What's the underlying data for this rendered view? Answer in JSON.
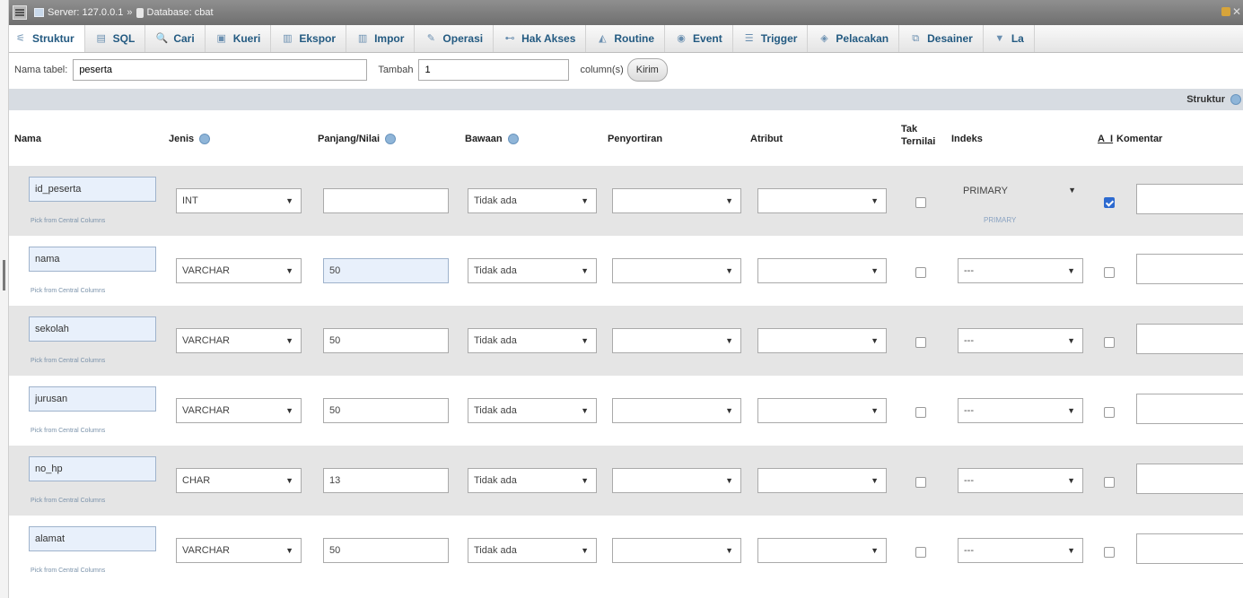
{
  "server_bar": {
    "server_label": "Server: 127.0.0.1",
    "database_label": "Database: cbat"
  },
  "tabs": [
    {
      "label": "Struktur",
      "icon": "structure-icon",
      "glyph": "⚟"
    },
    {
      "label": "SQL",
      "icon": "sql-icon",
      "glyph": "▤"
    },
    {
      "label": "Cari",
      "icon": "search-icon",
      "glyph": "🔍"
    },
    {
      "label": "Kueri",
      "icon": "query-icon",
      "glyph": "▣"
    },
    {
      "label": "Ekspor",
      "icon": "export-icon",
      "glyph": "▥"
    },
    {
      "label": "Impor",
      "icon": "import-icon",
      "glyph": "▥"
    },
    {
      "label": "Operasi",
      "icon": "wrench-icon",
      "glyph": "✎"
    },
    {
      "label": "Hak Akses",
      "icon": "privileges-icon",
      "glyph": "⊷"
    },
    {
      "label": "Routine",
      "icon": "routine-icon",
      "glyph": "◭"
    },
    {
      "label": "Event",
      "icon": "event-icon",
      "glyph": "◉"
    },
    {
      "label": "Trigger",
      "icon": "trigger-icon",
      "glyph": "☰"
    },
    {
      "label": "Pelacakan",
      "icon": "tracking-icon",
      "glyph": "◈"
    },
    {
      "label": "Desainer",
      "icon": "designer-icon",
      "glyph": "⧉"
    },
    {
      "label": "La",
      "icon": "more-icon",
      "glyph": "▼"
    }
  ],
  "table_form": {
    "name_label": "Nama tabel:",
    "name_value": "peserta",
    "add_label": "Tambah",
    "add_value": "1",
    "columns_label": "column(s)",
    "go_label": "Kirim"
  },
  "structure_bar": {
    "label": "Struktur"
  },
  "headers": {
    "nama": "Nama",
    "jenis": "Jenis",
    "panjang": "Panjang/Nilai",
    "bawaan": "Bawaan",
    "penyortiran": "Penyortiran",
    "atribut": "Atribut",
    "tak_ternilai_1": "Tak",
    "tak_ternilai_2": "Ternilai",
    "indeks": "Indeks",
    "ai": "A_I",
    "komentar": "Komentar"
  },
  "pick_label": "Pick from Central Columns",
  "rows": [
    {
      "name": "id_peserta",
      "type": "INT",
      "length": "",
      "default": "Tidak ada",
      "index": "PRIMARY",
      "index_sub": "PRIMARY",
      "ai": true
    },
    {
      "name": "nama",
      "type": "VARCHAR",
      "length": "50",
      "default": "Tidak ada",
      "index": "---",
      "index_sub": "",
      "ai": false
    },
    {
      "name": "sekolah",
      "type": "VARCHAR",
      "length": "50",
      "default": "Tidak ada",
      "index": "---",
      "index_sub": "",
      "ai": false
    },
    {
      "name": "jurusan",
      "type": "VARCHAR",
      "length": "50",
      "default": "Tidak ada",
      "index": "---",
      "index_sub": "",
      "ai": false
    },
    {
      "name": "no_hp",
      "type": "CHAR",
      "length": "13",
      "default": "Tidak ada",
      "index": "---",
      "index_sub": "",
      "ai": false
    },
    {
      "name": "alamat",
      "type": "VARCHAR",
      "length": "50",
      "default": "Tidak ada",
      "index": "---",
      "index_sub": "",
      "ai": false
    }
  ],
  "colors": {
    "accent": "#235a81",
    "row_alt": "#e5e5e5",
    "highlight": "#e8f0fb"
  }
}
